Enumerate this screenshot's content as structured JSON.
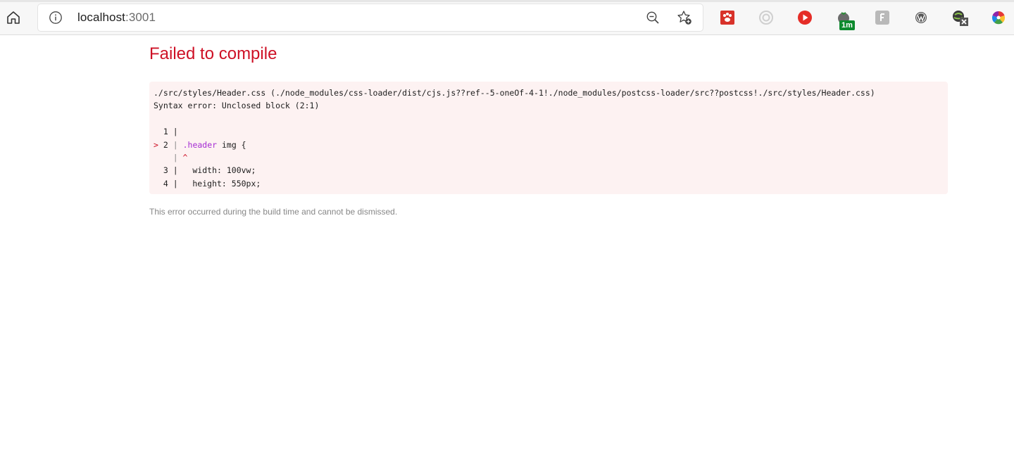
{
  "browser": {
    "url_host": "localhost",
    "url_port": ":3001",
    "download_badge": "1m",
    "icons": {
      "home": "home-icon",
      "info": "info-icon",
      "zoom": "zoom-out-icon",
      "favorite": "add-favorite-icon"
    }
  },
  "error": {
    "title": "Failed to compile",
    "code_lines": [
      "./src/styles/Header.css (./node_modules/css-loader/dist/cjs.js??ref--5-oneOf-4-1!./node_modules/postcss-loader/src??postcss!./src/styles/Header.css)",
      "Syntax error: Unclosed block (2:1)",
      "",
      "  1 |",
      "> 2 | .header img {",
      "    | ^",
      "  3 |   width: 100vw;",
      "  4 |   height: 550px;"
    ],
    "footer": "This error occurred during the build time and cannot be dismissed."
  },
  "colors": {
    "error_red": "#ce1126",
    "code_bg": "#fdf2f2",
    "selector_purple": "#a42bd3"
  }
}
